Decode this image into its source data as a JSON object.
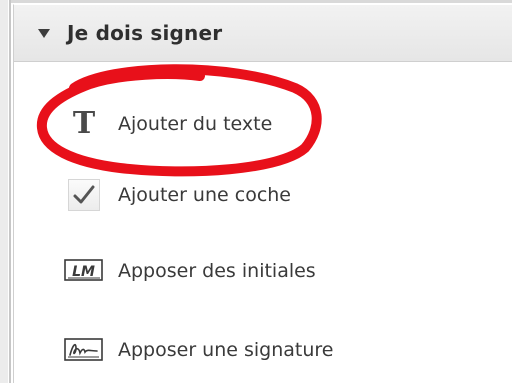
{
  "panel": {
    "title": "Je dois signer",
    "collapse_icon": "triangle-down-icon"
  },
  "items": [
    {
      "label": "Ajouter du texte",
      "icon": "text-t-icon"
    },
    {
      "label": "Ajouter une coche",
      "icon": "checkmark-icon"
    },
    {
      "label": "Apposer des initiales",
      "icon": "initials-icon",
      "icon_text": "LM"
    },
    {
      "label": "Apposer une signature",
      "icon": "signature-icon"
    }
  ],
  "annotation": {
    "shape": "freehand-ellipse",
    "color": "#e8101a"
  }
}
